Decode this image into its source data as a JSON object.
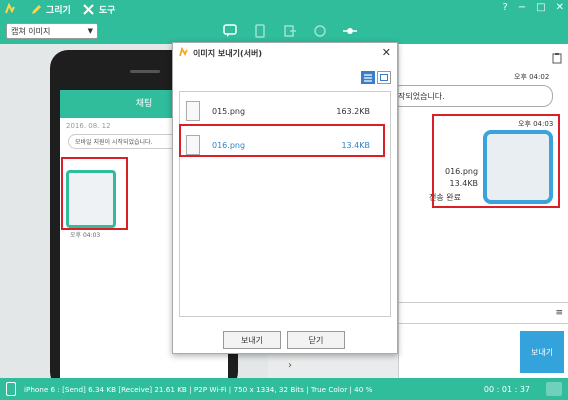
{
  "titlebar": {
    "menu_draw": "그리기",
    "menu_tools": "도구",
    "help": "?",
    "minimize": "−",
    "maximize": "□",
    "close": "✕"
  },
  "toolbar": {
    "capture_select": "캡쳐 이미지"
  },
  "phone": {
    "header": "채팅",
    "date": "2016. 08. 12",
    "system_msg": "모바일 지원이 시작되었습니다.",
    "thumb_time": "오후 04:03"
  },
  "chat": {
    "msg1_time": "오후 04:02",
    "msg1_text": "작되었습니다.",
    "msg2_time": "오후 04:03",
    "msg2_filename": "016.png",
    "msg2_size": "13.4KB",
    "msg2_status": "전송 완료",
    "send_button": "보내기"
  },
  "dialog": {
    "title": "이미지 보내기(서버)",
    "files": [
      {
        "name": "015.png",
        "size": "163.2KB",
        "selected": false
      },
      {
        "name": "016.png",
        "size": "13.4KB",
        "selected": true
      }
    ],
    "send_button": "보내기",
    "close_button": "닫기"
  },
  "statusbar": {
    "info": "iPhone 6 : [Send] 6.34 KB  [Receive] 21.61 KB | P2P Wi-Fi | 750 x 1334, 32 Bits | True Color | 40 %",
    "elapsed": "00 : 01 : 37"
  },
  "colors": {
    "brand": "#2fbd9c",
    "accent_blue": "#34a3db",
    "highlight_red": "#d92026"
  }
}
